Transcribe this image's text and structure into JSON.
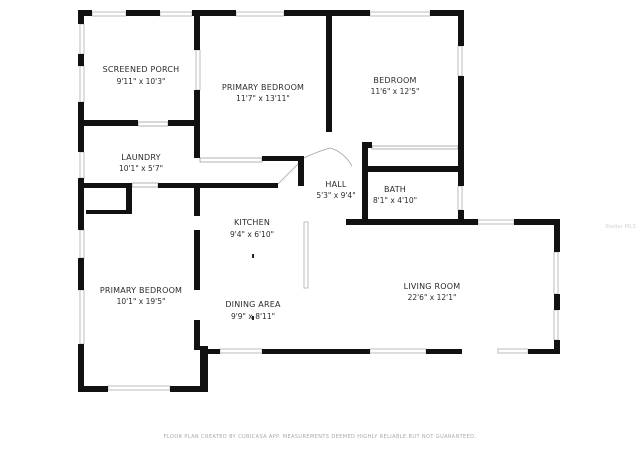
{
  "rooms": {
    "screened_porch": {
      "name": "SCREENED PORCH",
      "dims": "9'11\" x 10'3\""
    },
    "primary_bedroom_top": {
      "name": "PRIMARY BEDROOM",
      "dims": "11'7\" x 13'11\""
    },
    "bedroom": {
      "name": "BEDROOM",
      "dims": "11'6\" x 12'5\""
    },
    "laundry": {
      "name": "LAUNDRY",
      "dims": "10'1\" x 5'7\""
    },
    "hall": {
      "name": "HALL",
      "dims": "5'3\" x 9'4\""
    },
    "bath": {
      "name": "BATH",
      "dims": "8'1\" x 4'10\""
    },
    "kitchen": {
      "name": "KITCHEN",
      "dims": "9'4\" x 6'10\""
    },
    "living_room": {
      "name": "LIVING ROOM",
      "dims": "22'6\" x 12'1\""
    },
    "primary_bedroom_bottom": {
      "name": "PRIMARY BEDROOM",
      "dims": "10'1\" x 19'5\""
    },
    "dining_area": {
      "name": "DINING AREA",
      "dims": "9'9\" x 8'11\""
    }
  },
  "footer_note": "FLOOR PLAN CREATED BY CUBICASA APP. MEASUREMENTS DEEMED HIGHLY RELIABLE BUT NOT GUARANTEED.",
  "watermark": "Stellar MLS",
  "colors": {
    "wall": "#111111",
    "window": "#c8c8c8",
    "door": "#9a9a9a"
  }
}
